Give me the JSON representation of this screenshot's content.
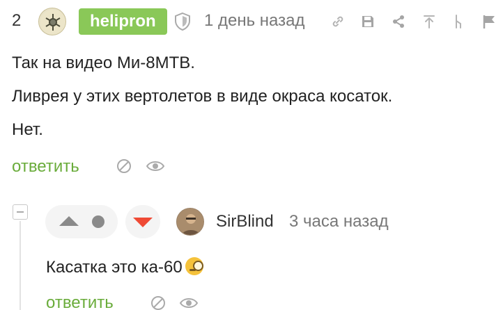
{
  "comment1": {
    "rating": "2",
    "author": "helipron",
    "time": "1 день назад",
    "lines": [
      "Так на видео Ми-8МТВ.",
      "Ливрея у этих вертолетов в виде окраса косаток.",
      "Нет."
    ],
    "reply_label": "ответить",
    "header_icons": [
      "link-icon",
      "save-icon",
      "share-icon",
      "parent-up-icon",
      "thread-icon",
      "flag-icon"
    ],
    "action_icons": [
      "hide-icon",
      "watch-icon"
    ]
  },
  "comment2": {
    "author": "SirBlind",
    "time": "3 часа назад",
    "text": "Касатка это ка-60",
    "emoji": "face-with-monocle",
    "reply_label": "ответить"
  },
  "colors": {
    "accent_green": "#6aac3b",
    "badge_green": "#8ac858",
    "downvote_red": "#ef4a35"
  }
}
